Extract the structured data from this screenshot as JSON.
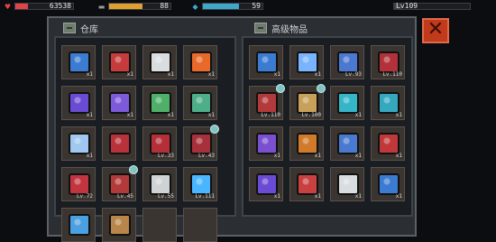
{
  "topbar": {
    "hp": {
      "value": "63538",
      "fraction": 0.22,
      "color": "#e04545"
    },
    "armor": {
      "value": "88",
      "fraction": 0.55,
      "color": "#e0a030"
    },
    "energy": {
      "value": "59",
      "fraction": 0.6,
      "color": "#3fa7c9"
    },
    "level": {
      "value": "Lv109",
      "fraction": 0.1,
      "color": "#3a3f45"
    }
  },
  "left_panel": {
    "title": "仓库",
    "slots": [
      {
        "icon": "cpu-chip-blue",
        "qty": "x1",
        "color": "#3b7bd1",
        "badge": false
      },
      {
        "icon": "heart-chip-red",
        "qty": "x1",
        "color": "#c63b3b",
        "badge": false
      },
      {
        "icon": "scroll-chip-white",
        "qty": "x1",
        "color": "#d9dde0",
        "badge": false
      },
      {
        "icon": "fire-gem",
        "qty": "x1",
        "color": "#e8692a",
        "badge": false
      },
      {
        "icon": "shield-chip-purple",
        "qty": "x1",
        "color": "#6a4bd3",
        "badge": false
      },
      {
        "icon": "shield-chip-violet",
        "qty": "x1",
        "color": "#7c5ad9",
        "badge": false
      },
      {
        "icon": "heart-chip-green",
        "qty": "x1",
        "color": "#4fb06a",
        "badge": false
      },
      {
        "icon": "heart-chip-teal",
        "qty": "x1",
        "color": "#4fae8a",
        "badge": false
      },
      {
        "icon": "ice-gem",
        "qty": "x1",
        "color": "#9fc7f0",
        "badge": false
      },
      {
        "icon": "red-armor",
        "qty": "",
        "color": "#b8323a",
        "badge": false
      },
      {
        "icon": "red-legguards",
        "qty": "Lv.33",
        "color": "#b42f38",
        "badge": false
      },
      {
        "icon": "red-boots",
        "qty": "Lv.43",
        "color": "#a8303a",
        "badge": true
      },
      {
        "icon": "red-mech-armor",
        "qty": "Lv.72",
        "color": "#c23440",
        "badge": false
      },
      {
        "icon": "red-gauntlet",
        "qty": "Lv.45",
        "color": "#b23a3a",
        "badge": true
      },
      {
        "icon": "red-blade",
        "qty": "Lv.55",
        "color": "#cfd3d6",
        "badge": false
      },
      {
        "icon": "blue-lightsaber",
        "qty": "Lv.111",
        "color": "#4ab6ff",
        "badge": false
      },
      {
        "icon": "blue-staff",
        "qty": "",
        "color": "#4aa0e0",
        "badge": false
      },
      {
        "icon": "wood-rod",
        "qty": "",
        "color": "#b8864a",
        "badge": false
      },
      {
        "icon": "empty",
        "qty": "",
        "color": "#3a3530",
        "badge": false
      },
      {
        "icon": "empty",
        "qty": "",
        "color": "#3a3530",
        "badge": false
      }
    ]
  },
  "right_panel": {
    "title": "高级物品",
    "slots": [
      {
        "icon": "cpu-chip-blue",
        "qty": "x1",
        "color": "#3b7bd1",
        "badge": false
      },
      {
        "icon": "ice-gem-burst",
        "qty": "x1",
        "color": "#7ab3ff",
        "badge": false
      },
      {
        "icon": "blue-legguards",
        "qty": "Lv.93",
        "color": "#4b79d1",
        "badge": false
      },
      {
        "icon": "red-armor",
        "qty": "Lv.110",
        "color": "#b3313a",
        "badge": false
      },
      {
        "icon": "red-helmet",
        "qty": "Lv.110",
        "color": "#b23a3a",
        "badge": true
      },
      {
        "icon": "red-sword",
        "qty": "Lv.100",
        "color": "#c8a05a",
        "badge": true
      },
      {
        "icon": "cyan-chip",
        "qty": "x1",
        "color": "#35b6c8",
        "badge": false
      },
      {
        "icon": "cyan-chip-2",
        "qty": "x1",
        "color": "#35a8c0",
        "badge": false
      },
      {
        "icon": "purple-chip",
        "qty": "x1",
        "color": "#7a50d0",
        "badge": false
      },
      {
        "icon": "orange-chip",
        "qty": "x1",
        "color": "#d07a2a",
        "badge": false
      },
      {
        "icon": "blue-chip",
        "qty": "x1",
        "color": "#4a7ad0",
        "badge": false
      },
      {
        "icon": "red-chip",
        "qty": "x1",
        "color": "#c0383a",
        "badge": false
      },
      {
        "icon": "purple-chip-2",
        "qty": "x1",
        "color": "#6a4bd3",
        "badge": false
      },
      {
        "icon": "red-chip-2",
        "qty": "x1",
        "color": "#c84040",
        "badge": false
      },
      {
        "icon": "white-chip",
        "qty": "x1",
        "color": "#d9dde0",
        "badge": false
      },
      {
        "icon": "blue-chip-2",
        "qty": "x1",
        "color": "#3b7bd1",
        "badge": false
      }
    ]
  },
  "close_button": {
    "label": "✕"
  }
}
